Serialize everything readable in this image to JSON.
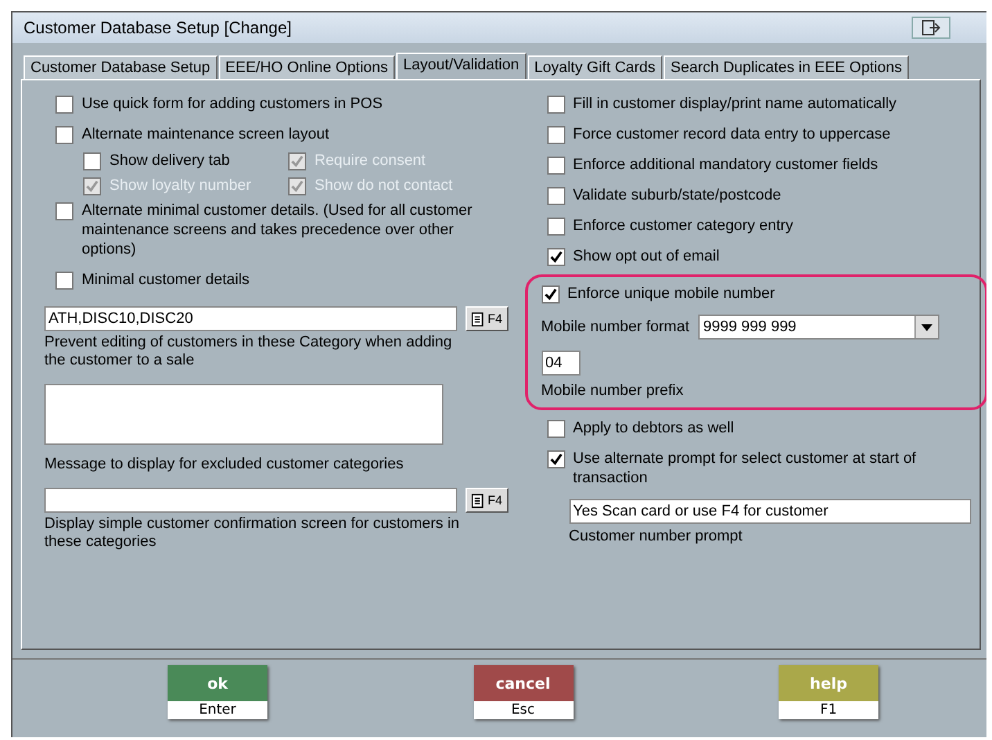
{
  "window": {
    "title": "Customer Database Setup  [Change]"
  },
  "tabs": [
    {
      "label": "Customer Database Setup",
      "selected": false
    },
    {
      "label": "EEE/HO Online Options",
      "selected": false
    },
    {
      "label": "Layout/Validation",
      "selected": true
    },
    {
      "label": "Loyalty Gift Cards",
      "selected": false
    },
    {
      "label": "Search Duplicates in EEE Options",
      "selected": false
    }
  ],
  "left_options": [
    {
      "label": "Use quick form for adding customers in POS",
      "checked": false,
      "disabled": false
    },
    {
      "label": "Alternate maintenance screen layout",
      "checked": false,
      "disabled": false,
      "children": [
        {
          "label": "Show delivery tab",
          "checked": false,
          "disabled": false
        },
        {
          "label": "Require consent",
          "checked": true,
          "disabled": true
        },
        {
          "label": "Show loyalty number",
          "checked": true,
          "disabled": true
        },
        {
          "label": "Show do not contact",
          "checked": true,
          "disabled": true
        }
      ]
    },
    {
      "label": "Alternate minimal customer details.  (Used for all customer maintenance screens and takes precedence over other options)",
      "checked": false,
      "disabled": false
    },
    {
      "label": "Minimal customer details",
      "checked": false,
      "disabled": false
    }
  ],
  "left_fields": [
    {
      "kind": "lookup",
      "value": "ATH,DISC10,DISC20",
      "button": "F4",
      "description": "Prevent editing of customers in these Category when adding the customer to a sale"
    },
    {
      "kind": "memo",
      "description": "Message to display for excluded customer categories"
    },
    {
      "kind": "lookup",
      "button": "F4",
      "description": "Display simple customer confirmation screen for customers in these categories"
    }
  ],
  "right_options": [
    {
      "label": "Fill in customer display/print name automatically",
      "checked": false
    },
    {
      "label": "Force customer record data entry to uppercase",
      "checked": false
    },
    {
      "label": "Enforce additional mandatory customer fields",
      "checked": false
    },
    {
      "label": "Validate suburb/state/postcode",
      "checked": false
    },
    {
      "label": "Enforce customer category entry",
      "checked": false
    },
    {
      "label": "Show opt out of email",
      "checked": true
    }
  ],
  "mobile": {
    "enforce_unique": {
      "label": "Enforce unique mobile number",
      "checked": true
    },
    "format_label": "Mobile number format",
    "format_value": "9999 999 999",
    "prefix_value": "04",
    "prefix_label": "Mobile number prefix"
  },
  "more_options": [
    {
      "label": "Apply to debtors as well",
      "checked": false
    },
    {
      "label": "Use alternate prompt for select customer at start of transaction",
      "checked": true
    }
  ],
  "prompt": {
    "value": "Yes Scan card or use F4 for customer",
    "label": "Customer number prompt"
  },
  "buttons": [
    {
      "kind": "ok",
      "label": "ok",
      "key": "Enter"
    },
    {
      "kind": "cancel",
      "label": "cancel",
      "key": "Esc"
    },
    {
      "kind": "help",
      "label": "help",
      "key": "F1"
    }
  ]
}
